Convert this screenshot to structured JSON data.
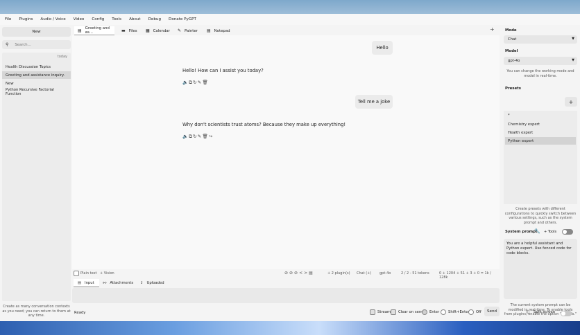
{
  "menu": [
    "File",
    "Plugins",
    "Audio / Voice",
    "Video",
    "Config",
    "Tools",
    "About",
    "Debug",
    "Donate PyGPT"
  ],
  "left": {
    "new_label": "New",
    "search_placeholder": "Search...",
    "today": "today",
    "contexts": [
      "Health Discussion Topics",
      "Greeting and assistance inquiry.",
      "New",
      "Python Recursive Factorial Function"
    ],
    "footer": "Create as many conversation contexts as you need; you can return to them at any time."
  },
  "tabs": [
    "Greeting and as...",
    "Files",
    "Calendar",
    "Painter",
    "Notepad"
  ],
  "chat": {
    "messages": [
      {
        "role": "user",
        "text": "Hello"
      },
      {
        "role": "bot",
        "text": "Hello! How can I assist you today?"
      },
      {
        "role": "user",
        "text": "Tell me a joke"
      },
      {
        "role": "bot",
        "text": "Why don't scientists trust atoms? Because they make up everything!"
      }
    ]
  },
  "status": {
    "plain_text": "Plain text",
    "vision": "+ Vision",
    "plugins": "+ 2 plugin(s)",
    "mode": "Chat (+)",
    "model": "gpt-4o",
    "ctx": "2 / 2 - 51 tokens",
    "tokens": "0 + 1204 + 51 + 3 + 0 = 1k / 128k"
  },
  "input_tabs": [
    "Input",
    "Attachments",
    "Uploaded"
  ],
  "bottom": {
    "ready": "Ready",
    "stream": "Stream",
    "clear_on_send": "Clear on send",
    "enter": "Enter",
    "shift_enter": "Shift+Enter",
    "off": "Off",
    "send": "Send"
  },
  "right": {
    "mode_label": "Mode",
    "mode_value": "Chat",
    "model_label": "Model",
    "model_value": "gpt-4o",
    "model_hint": "You can change the working mode and model in real-time.",
    "presets_label": "Presets",
    "presets": [
      "*",
      "Chemistry expert",
      "Health expert",
      "Python expert"
    ],
    "presets_hint": "Create presets with different configurations to quickly switch between various settings, such as the system prompt and others.",
    "system_prompt_label": "System prompt",
    "tools_label": "+ Tools",
    "system_prompt": "You are a helpful assistant and Python expert. Use fenced code for code blocks.",
    "system_hint": "The current system prompt can be modified in real-time. To enable tools from plugins, enable the option \"+ Tools.\"",
    "split_screen": "Split screen"
  }
}
